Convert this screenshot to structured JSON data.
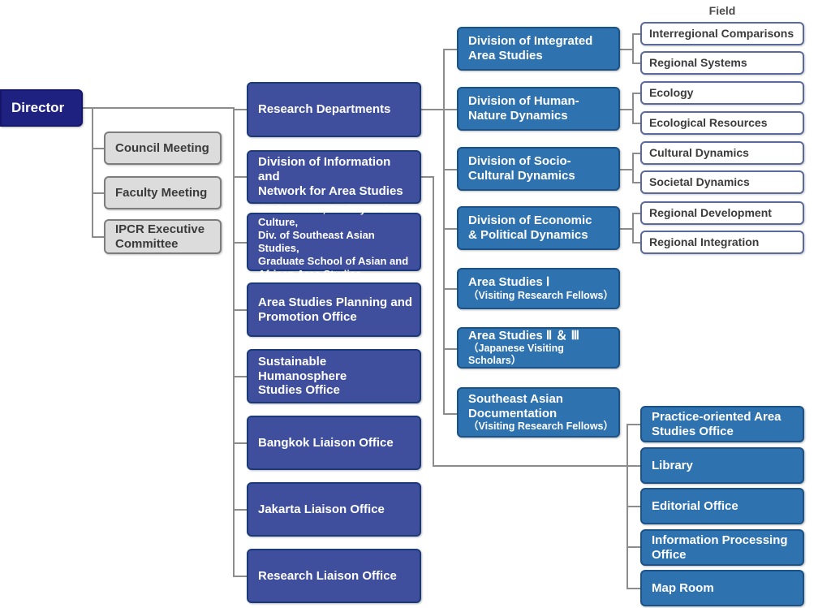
{
  "chart_title": "Field",
  "colors": {
    "director": "#1f2180",
    "committee": "#dcdcdc",
    "center_column": "#3f4f9e",
    "division": "#2e72b0",
    "field": "#ffffff",
    "connector": "#8c8c8c"
  },
  "root": {
    "label": "Director"
  },
  "committees": [
    {
      "label": "Council Meeting"
    },
    {
      "label": "Faculty Meeting"
    },
    {
      "label": "IPCR Executive\nCommittee"
    }
  ],
  "center_column": [
    {
      "label": "Research Departments"
    },
    {
      "label": "Division of Information and\nNetwork for Area Studies"
    },
    {
      "label": "Environment, Society and Culture,\nDiv. of Southeast Asian Studies,\nGraduate School of Asian and\nAfrican Area Studies"
    },
    {
      "label": "Area Studies Planning and\nPromotion Office"
    },
    {
      "label": "Sustainable Humanosphere\nStudies Office"
    },
    {
      "label": "Bangkok Liaison Office"
    },
    {
      "label": "Jakarta Liaison Office"
    },
    {
      "label": "Research Liaison Office"
    }
  ],
  "divisions": [
    {
      "label": "Division of Integrated\nArea Studies",
      "sub": ""
    },
    {
      "label": "Division of Human-\nNature Dynamics",
      "sub": ""
    },
    {
      "label": "Division of Socio-\nCultural Dynamics",
      "sub": ""
    },
    {
      "label": "Division of Economic\n& Political Dynamics",
      "sub": ""
    },
    {
      "label": "Area Studies Ⅰ",
      "sub": "（Visiting Research Fellows）"
    },
    {
      "label": "Area Studies Ⅱ ＆ Ⅲ",
      "sub": "（Japanese Visiting Scholars）"
    },
    {
      "label": "Southeast Asian\nDocumentation",
      "sub": "（Visiting Research Fellows）"
    }
  ],
  "fields": [
    {
      "label": "Interregional Comparisons"
    },
    {
      "label": "Regional Systems"
    },
    {
      "label": "Ecology"
    },
    {
      "label": "Ecological Resources"
    },
    {
      "label": "Cultural Dynamics"
    },
    {
      "label": "Societal Dynamics"
    },
    {
      "label": "Regional Development"
    },
    {
      "label": "Regional Integration"
    }
  ],
  "support_offices": [
    {
      "label": "Practice-oriented Area\nStudies Office"
    },
    {
      "label": "Library"
    },
    {
      "label": "Editorial Office"
    },
    {
      "label": "Information Processing\nOffice"
    },
    {
      "label": "Map Room"
    }
  ]
}
